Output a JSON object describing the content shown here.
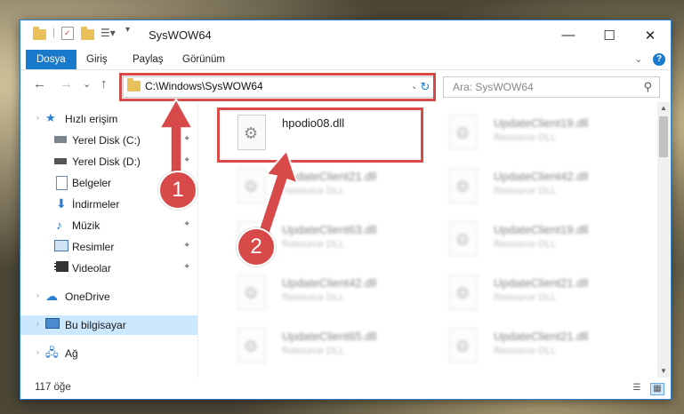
{
  "window": {
    "title": "SysWOW64"
  },
  "ribbon": {
    "tabs": [
      "Dosya",
      "Giriş",
      "Paylaş",
      "Görünüm"
    ]
  },
  "window_buttons": {
    "minimize": "—",
    "maximize": "☐",
    "close": "✕"
  },
  "nav": {
    "back": "←",
    "forward": "→",
    "recent": "⌄",
    "up": "↑",
    "address": "C:\\Windows\\SysWOW64",
    "dropdown": "⌄",
    "refresh": "↻",
    "search_placeholder": "Ara: SysWOW64",
    "search_icon": "⚲"
  },
  "sidebar": {
    "items": [
      {
        "label": "Hızlı erişim",
        "icon": "star-icon",
        "pinned": false
      },
      {
        "label": "Yerel Disk (C:)",
        "icon": "drive-icon",
        "pinned": true
      },
      {
        "label": "Yerel Disk (D:)",
        "icon": "drive-icon",
        "pinned": true
      },
      {
        "label": "Belgeler",
        "icon": "documents-icon",
        "pinned": true
      },
      {
        "label": "İndirmeler",
        "icon": "download-icon",
        "pinned": true
      },
      {
        "label": "Müzik",
        "icon": "music-icon",
        "pinned": true
      },
      {
        "label": "Resimler",
        "icon": "pictures-icon",
        "pinned": true
      },
      {
        "label": "Videolar",
        "icon": "video-icon",
        "pinned": true
      },
      {
        "label": "OneDrive",
        "icon": "cloud-icon",
        "pinned": false
      },
      {
        "label": "Bu bilgisayar",
        "icon": "computer-icon",
        "pinned": false
      },
      {
        "label": "Ağ",
        "icon": "network-icon",
        "pinned": false
      }
    ],
    "pin_glyph": "📌"
  },
  "files": [
    {
      "name": "hpodio08.dll",
      "desc": ""
    },
    {
      "name": "UpdateClient19.dll",
      "desc": "Resource DLL"
    },
    {
      "name": "UpdateClient21.dll",
      "desc": "Resource DLL"
    },
    {
      "name": "UpdateClient42.dll",
      "desc": "Resource DLL"
    },
    {
      "name": "UpdateClient63.dll",
      "desc": "Resource DLL"
    },
    {
      "name": "UpdateClient19.dll",
      "desc": "Resource DLL"
    },
    {
      "name": "UpdateClient42.dll",
      "desc": "Resource DLL"
    },
    {
      "name": "UpdateClient21.dll",
      "desc": "Resource DLL"
    },
    {
      "name": "UpdateClient65.dll",
      "desc": "Resource DLL"
    },
    {
      "name": "UpdateClient21.dll",
      "desc": "Resource DLL"
    }
  ],
  "status": {
    "count": "117 öğe"
  },
  "annotations": {
    "step1": "1",
    "step2": "2",
    "color": "#d84a4a"
  }
}
